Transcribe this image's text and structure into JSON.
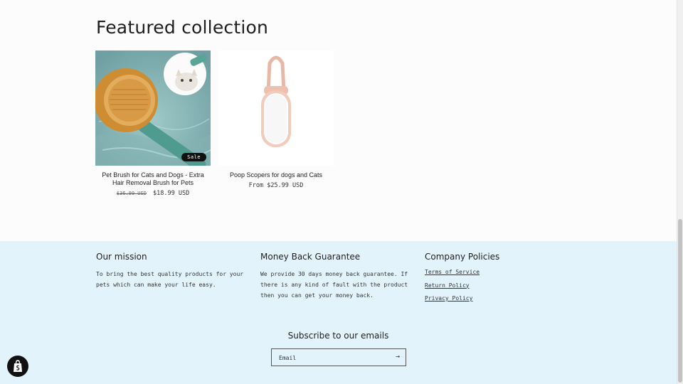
{
  "featured": {
    "title": "Featured collection",
    "products": [
      {
        "title": "Pet Brush for Cats and Dogs - Extra Hair Removal Brush for Pets",
        "price_compare": "$36.99 USD",
        "price": "$18.99 USD",
        "badge": "Sale"
      },
      {
        "title": "Poop Scopers for dogs and Cats",
        "price": "From $25.99 USD"
      }
    ]
  },
  "footer": {
    "mission": {
      "heading": "Our mission",
      "text": "To bring the best quality products for your pets which can make your life easy."
    },
    "guarantee": {
      "heading": "Money Back Guarantee",
      "text": "We provide 30 days money back guarantee. If there is any kind of fault with the product then you can get your money back."
    },
    "policies": {
      "heading": "Company Policies",
      "links": [
        "Terms of Service",
        "Return Policy",
        "Privacy Policy"
      ]
    },
    "subscribe": {
      "title": "Subscribe to our emails",
      "placeholder": "Email",
      "arrow": "→"
    }
  },
  "icons": {
    "shopify": "shopify-bag-icon",
    "submit": "arrow-right-icon"
  },
  "colors": {
    "footer_bg": "#e3f3fc",
    "badge_bg": "#111111"
  }
}
